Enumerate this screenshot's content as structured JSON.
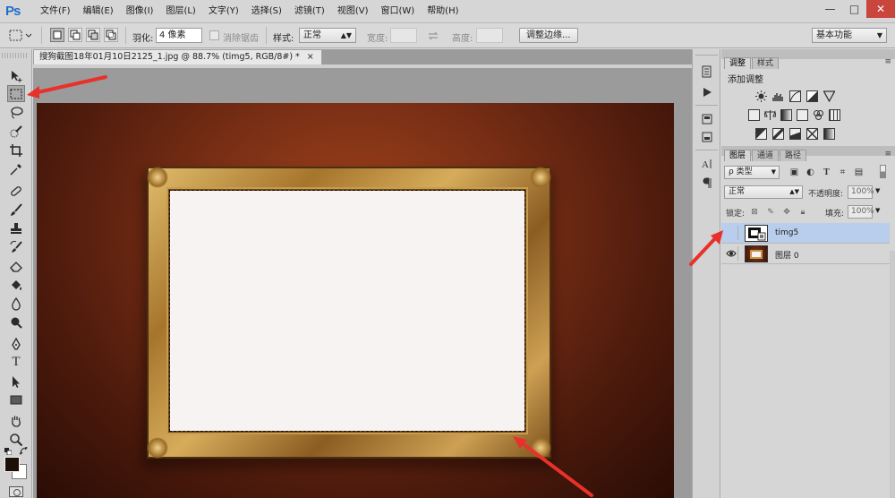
{
  "app": {
    "logo": "Ps",
    "menus": [
      "文件(F)",
      "编辑(E)",
      "图像(I)",
      "图层(L)",
      "文字(Y)",
      "选择(S)",
      "滤镜(T)",
      "视图(V)",
      "窗口(W)",
      "帮助(H)"
    ],
    "window_controls": {
      "minimize": "—",
      "maximize": "□",
      "close": "✕"
    }
  },
  "options_bar": {
    "feather_label": "羽化:",
    "feather_value": "4 像素",
    "antialias_label": "消除锯齿",
    "style_label": "样式:",
    "style_value": "正常",
    "width_label": "宽度:",
    "height_label": "高度:",
    "refine_edge_button": "调整边缘...",
    "workspace": "基本功能"
  },
  "document": {
    "tab_title": "搜狗截图18年01月10日2125_1.jpg @ 88.7% (timg5, RGB/8#) *",
    "tab_close": "×"
  },
  "tools": [
    {
      "name": "move-tool",
      "icon": "move-icon"
    },
    {
      "name": "rectangular-marquee-tool",
      "icon": "marquee-icon",
      "active": true
    },
    {
      "name": "lasso-tool",
      "icon": "lasso-icon"
    },
    {
      "name": "quick-selection-tool",
      "icon": "quick-selection-icon"
    },
    {
      "name": "crop-tool",
      "icon": "crop-icon"
    },
    {
      "name": "eyedropper-tool",
      "icon": "eyedropper-icon"
    },
    {
      "name": "healing-brush-tool",
      "icon": "bandage-icon"
    },
    {
      "name": "brush-tool",
      "icon": "brush-icon"
    },
    {
      "name": "clone-stamp-tool",
      "icon": "stamp-icon"
    },
    {
      "name": "history-brush-tool",
      "icon": "history-brush-icon"
    },
    {
      "name": "eraser-tool",
      "icon": "eraser-icon"
    },
    {
      "name": "paint-bucket-tool",
      "icon": "bucket-icon"
    },
    {
      "name": "blur-tool",
      "icon": "drop-icon"
    },
    {
      "name": "dodge-tool",
      "icon": "dodge-icon"
    },
    {
      "name": "pen-tool",
      "icon": "pen-icon"
    },
    {
      "name": "type-tool",
      "icon": "type-icon",
      "glyph": "T"
    },
    {
      "name": "path-selection-tool",
      "icon": "arrow-icon"
    },
    {
      "name": "shape-tool",
      "icon": "rectangle-icon"
    },
    {
      "name": "hand-tool",
      "icon": "hand-icon"
    },
    {
      "name": "zoom-tool",
      "icon": "zoom-icon"
    }
  ],
  "colors": {
    "foreground": "#1d0e08",
    "background": "#ffffff",
    "annotation_arrow": "#e8312a",
    "selection_highlight": "#b9cdec"
  },
  "panels": {
    "adjustments": {
      "tabs": [
        "调整",
        "样式"
      ],
      "title": "添加调整"
    },
    "layers": {
      "tabs": [
        "图层",
        "通道",
        "路径"
      ],
      "filter_kind": "ρ 类型",
      "blend_mode": "正常",
      "opacity_label": "不透明度:",
      "opacity_value": "100%",
      "lock_label": "锁定:",
      "fill_label": "填充:",
      "fill_value": "100%",
      "rows": [
        {
          "name": "timg5",
          "visible": false,
          "selected": true
        },
        {
          "name": "图层 0",
          "visible": true,
          "selected": false
        }
      ]
    }
  }
}
